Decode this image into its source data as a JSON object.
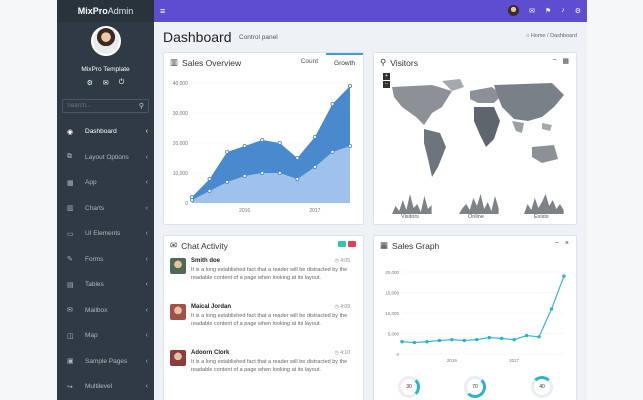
{
  "brand": {
    "name_bold": "MixPro",
    "name_light": "Admin"
  },
  "user": {
    "name": "MixPro Template"
  },
  "search": {
    "placeholder": "Search..."
  },
  "sidebar": {
    "items": [
      {
        "label": "Dashboard",
        "icon": "dashboard-icon",
        "active": true
      },
      {
        "label": "Layout Options",
        "icon": "layout-icon"
      },
      {
        "label": "App",
        "icon": "grid-icon"
      },
      {
        "label": "Charts",
        "icon": "bar-chart-icon"
      },
      {
        "label": "UI Elements",
        "icon": "monitor-icon"
      },
      {
        "label": "Forms",
        "icon": "edit-icon"
      },
      {
        "label": "Tables",
        "icon": "table-icon"
      },
      {
        "label": "Mailbox",
        "icon": "mail-icon"
      },
      {
        "label": "Map",
        "icon": "map-icon"
      },
      {
        "label": "Sample Pages",
        "icon": "pages-icon"
      },
      {
        "label": "Multilevel",
        "icon": "share-icon"
      }
    ]
  },
  "page": {
    "title": "Dashboard",
    "subtitle": "Control panel",
    "breadcrumb_home": "Home",
    "breadcrumb_current": "Dashboard"
  },
  "sales_overview": {
    "title": "Sales Overview",
    "tabs": [
      "Count",
      "Growth"
    ],
    "active_tab": "Growth",
    "chart_data": {
      "type": "area",
      "x": [
        "",
        "",
        "",
        "2016",
        "",
        "",
        "",
        "2017",
        "",
        ""
      ],
      "ylim": [
        0,
        40000
      ],
      "yticks": [
        "40,000",
        "30,000",
        "20,000",
        "10,000",
        "0"
      ],
      "series": [
        {
          "values": [
            2000,
            8000,
            17000,
            19000,
            21000,
            20000,
            15000,
            22000,
            33000,
            39000
          ]
        },
        {
          "values": [
            1000,
            4000,
            7000,
            9000,
            10000,
            10000,
            8000,
            12000,
            17000,
            19000
          ]
        }
      ],
      "colors": [
        "#3f84cc",
        "#a7c8ee"
      ]
    }
  },
  "visitors": {
    "title": "Visitors",
    "labels": [
      "Visitors",
      "Online",
      "Exists"
    ]
  },
  "chat": {
    "title": "Chat Activity",
    "messages": [
      {
        "name": "Smith doe",
        "time": "4:05",
        "text": "It is a long established fact that a reader will be distracted by the readable content of a page when looking at its layout."
      },
      {
        "name": "Maical Jordan",
        "time": "4:09",
        "text": "It is a long established fact that a reader will be distracted by the readable content of a page when looking at its layout."
      },
      {
        "name": "Adoorn Clork",
        "time": "4:10",
        "text": "It is a long established fact that a reader will be distracted by the readable content of a page when looking at its layout."
      }
    ]
  },
  "sales_graph": {
    "title": "Sales Graph",
    "chart_data": {
      "type": "line",
      "x": [
        "",
        "",
        "",
        "",
        "2016",
        "",
        "",
        "",
        "",
        "2017",
        "",
        "",
        "",
        ""
      ],
      "ylim": [
        0,
        20000
      ],
      "yticks": [
        "20,000",
        "15,000",
        "10,000",
        "5,000",
        "0"
      ],
      "values": [
        3000,
        2800,
        3000,
        3300,
        3500,
        3300,
        3500,
        4000,
        3800,
        3500,
        4500,
        4200,
        11000,
        19000
      ],
      "color": "#26b5c9"
    },
    "rings": [
      "30",
      "70",
      "40"
    ]
  }
}
